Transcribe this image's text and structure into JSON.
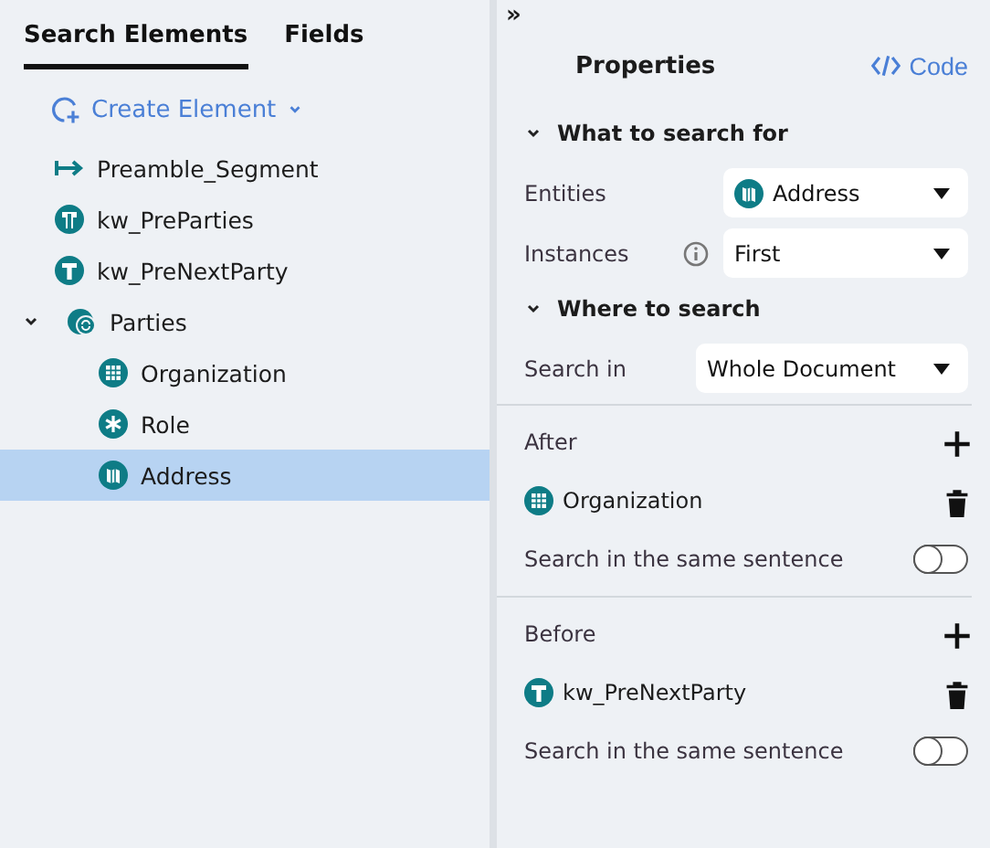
{
  "tabs": [
    {
      "label": "Search Elements",
      "selected": true
    },
    {
      "label": "Fields",
      "selected": false
    }
  ],
  "create_button": {
    "label": "Create Element"
  },
  "tree": [
    {
      "label": "Preamble_Segment",
      "kind": "segment",
      "selected": false
    },
    {
      "label": "kw_PreParties",
      "kind": "keyword-i",
      "selected": false
    },
    {
      "label": "kw_PreNextParty",
      "kind": "keyword-t",
      "selected": false
    },
    {
      "label": "Parties",
      "kind": "group",
      "selected": false,
      "expanded": true,
      "children": [
        {
          "label": "Organization",
          "kind": "table",
          "selected": false
        },
        {
          "label": "Role",
          "kind": "asterisk",
          "selected": false
        },
        {
          "label": "Address",
          "kind": "address",
          "selected": true
        }
      ]
    }
  ],
  "collapse_toggle": "»",
  "properties": {
    "title": "Properties",
    "code_link": "Code",
    "sections": [
      {
        "title": "What to search for",
        "expanded": true,
        "fields": [
          {
            "label": "Entities",
            "value": "Address",
            "kind": "address"
          },
          {
            "label": "Instances",
            "value": "First",
            "info": true
          }
        ]
      },
      {
        "title": "Where to search",
        "expanded": true,
        "fields": [
          {
            "label": "Search in",
            "value": "Whole Document"
          }
        ]
      }
    ],
    "constraints": [
      {
        "title": "After",
        "items": [
          {
            "label": "Organization",
            "kind": "table"
          }
        ],
        "same_sentence": {
          "label": "Search in the same sentence",
          "on": false
        }
      },
      {
        "title": "Before",
        "items": [
          {
            "label": "kw_PreNextParty",
            "kind": "keyword-t"
          }
        ],
        "same_sentence": {
          "label": "Search in the same sentence",
          "on": false
        }
      }
    ]
  }
}
